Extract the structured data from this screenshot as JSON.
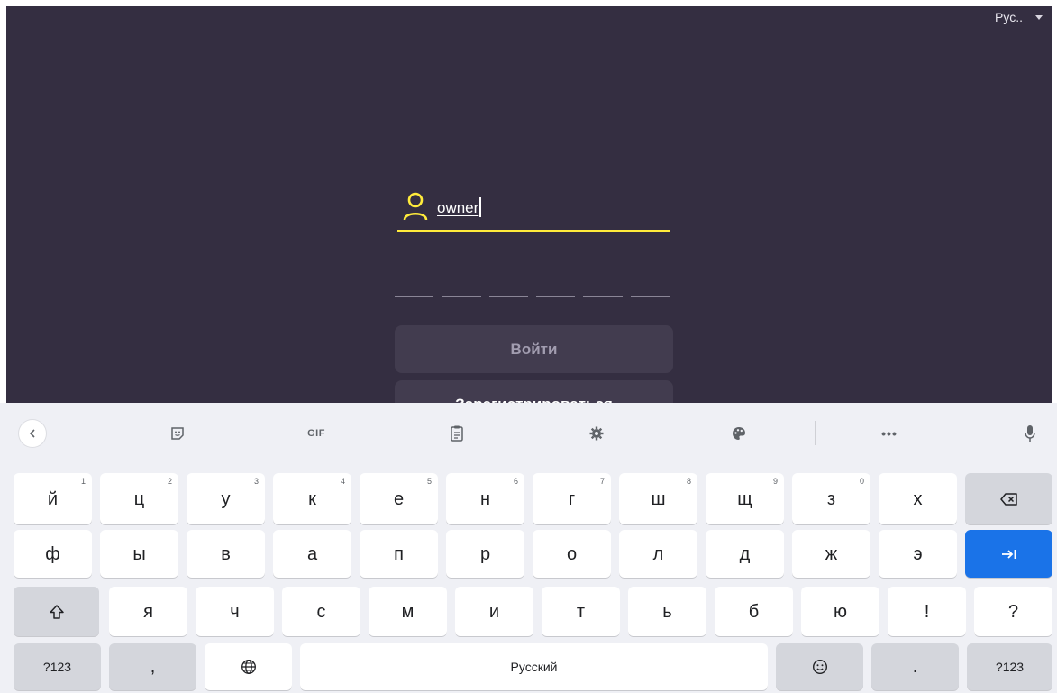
{
  "app": {
    "language_selector": "Рус..",
    "login_value": "owner",
    "pin_slots": 6,
    "login_button": "Войти",
    "register_button": "Зарегистрироваться",
    "colors": {
      "background": "#342e41",
      "accent": "#ffeb3b",
      "button": "#423c4f"
    }
  },
  "keyboard": {
    "toolbar": [
      "back-icon",
      "sticker-icon",
      "gif-icon",
      "clipboard-icon",
      "settings-icon",
      "palette-icon",
      "more-icon",
      "microphone-icon"
    ],
    "gif_label": "GIF",
    "more_label": "•••",
    "row1": [
      {
        "label": "й",
        "hint": "1"
      },
      {
        "label": "ц",
        "hint": "2"
      },
      {
        "label": "у",
        "hint": "3"
      },
      {
        "label": "к",
        "hint": "4"
      },
      {
        "label": "е",
        "hint": "5"
      },
      {
        "label": "н",
        "hint": "6"
      },
      {
        "label": "г",
        "hint": "7"
      },
      {
        "label": "ш",
        "hint": "8"
      },
      {
        "label": "щ",
        "hint": "9"
      },
      {
        "label": "з",
        "hint": "0"
      },
      {
        "label": "х",
        "hint": ""
      }
    ],
    "row2": [
      "ф",
      "ы",
      "в",
      "а",
      "п",
      "р",
      "о",
      "л",
      "д",
      "ж",
      "э"
    ],
    "row3": [
      "я",
      "ч",
      "с",
      "м",
      "и",
      "т",
      "ь",
      "б",
      "ю",
      "!",
      "?"
    ],
    "symbols_key": "?123",
    "comma_key": ",",
    "space_key": "Русский",
    "period_key": ".",
    "colors": {
      "enter_key": "#1a73e8",
      "keyboard_bg": "#eff0f5"
    }
  }
}
